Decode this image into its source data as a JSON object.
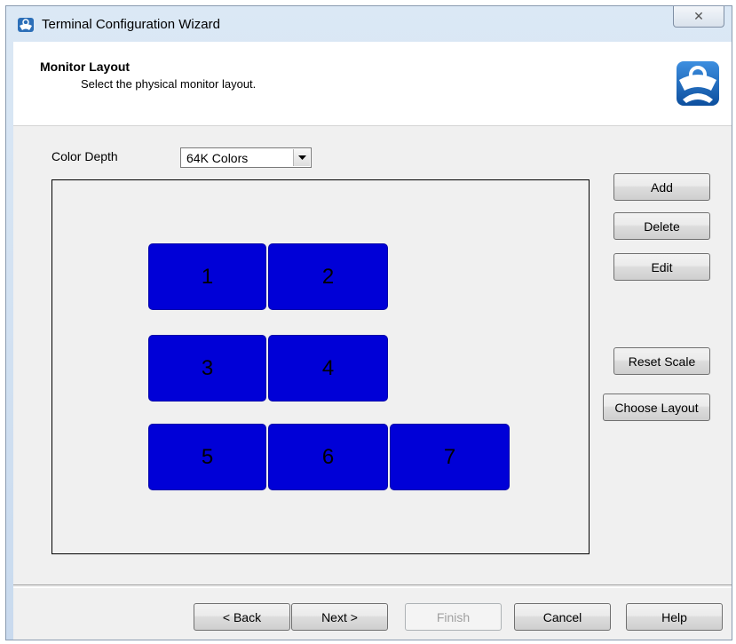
{
  "window": {
    "title": "Terminal Configuration Wizard",
    "close_symbol": "✕"
  },
  "header": {
    "title": "Monitor Layout",
    "subtitle": "Select the physical monitor layout."
  },
  "color_depth": {
    "label": "Color Depth",
    "value": "64K Colors"
  },
  "monitors": [
    {
      "label": "1"
    },
    {
      "label": "2"
    },
    {
      "label": "3"
    },
    {
      "label": "4"
    },
    {
      "label": "5"
    },
    {
      "label": "6"
    },
    {
      "label": "7"
    }
  ],
  "side_buttons": {
    "add": "Add",
    "delete": "Delete",
    "edit": "Edit",
    "reset_scale": "Reset Scale",
    "choose_layout": "Choose Layout"
  },
  "footer_buttons": {
    "back": "< Back",
    "next": "Next >",
    "finish": "Finish",
    "cancel": "Cancel",
    "help": "Help"
  },
  "colors": {
    "monitor_fill": "#0000d7",
    "logo_blue": "#1a6fc4"
  },
  "icons": {
    "title_icon": "thinmanager-icon",
    "logo": "thinmanager-logo",
    "dropdown": "chevron-down-icon",
    "close": "close-icon"
  }
}
